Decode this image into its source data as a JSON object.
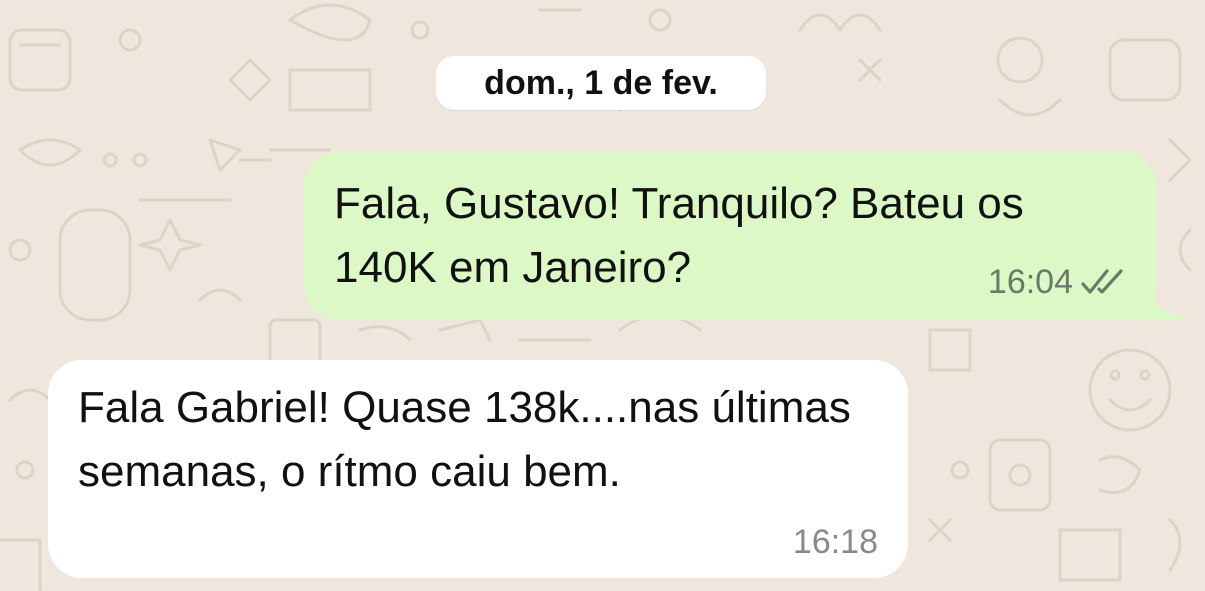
{
  "chat": {
    "date_separator": "dom., 1 de fev.",
    "messages": [
      {
        "direction": "outgoing",
        "text": "Fala, Gustavo! Tranquilo? Bateu os 140K em Janeiro?",
        "time": "16:04",
        "status": "read",
        "status_icon": "double-check-icon"
      },
      {
        "direction": "incoming",
        "text": "Fala Gabriel! Quase 138k....nas últimas semanas, o rítmo caiu bem.",
        "time": "16:18"
      }
    ]
  },
  "colors": {
    "wallpaper": "#efe7dd",
    "outgoing_bubble": "#dcf8c6",
    "incoming_bubble": "#ffffff",
    "meta_text": "#6b7b70"
  }
}
